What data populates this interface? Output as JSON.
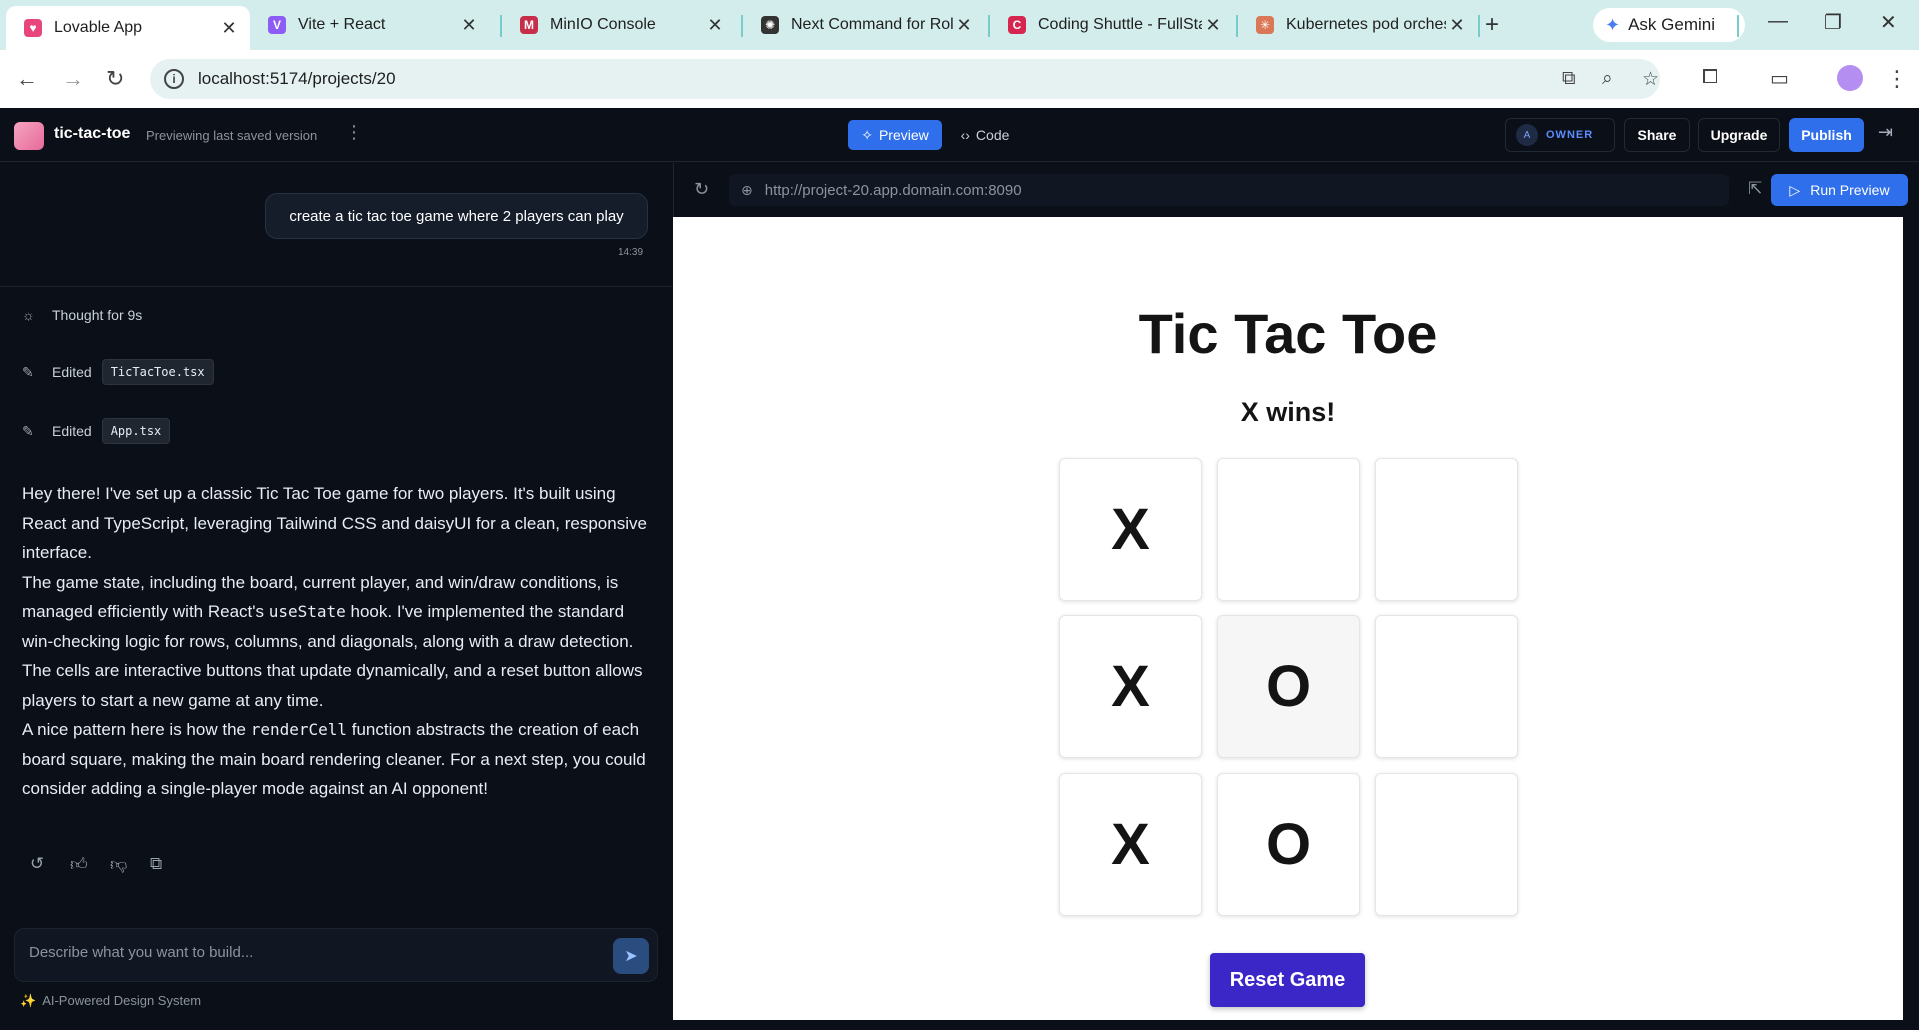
{
  "browser": {
    "tabs": [
      {
        "title": "Lovable App",
        "icon": "lovable-heart-icon",
        "color": "#e8457a",
        "active": true
      },
      {
        "title": "Vite + React",
        "icon": "vite-icon",
        "color": "#8c5cf5",
        "active": false
      },
      {
        "title": "MinIO Console",
        "icon": "minio-icon",
        "color": "#c72e49",
        "active": false
      },
      {
        "title": "Next Command for Rol",
        "icon": "chatgpt-icon",
        "color": "#333333",
        "active": false
      },
      {
        "title": "Coding Shuttle - FullSta",
        "icon": "coding-shuttle-icon",
        "color": "#d6264f",
        "active": false
      },
      {
        "title": "Kubernetes pod orches",
        "icon": "claude-icon",
        "color": "#d97757",
        "active": false
      }
    ],
    "gemini_label": "Ask Gemini",
    "url": "localhost:5174/projects/20"
  },
  "app": {
    "project_name": "tic-tac-toe",
    "status": "Previewing last saved version",
    "preview_label": "Preview",
    "code_label": "Code",
    "avatar_initial": "A",
    "role": "OWNER",
    "share_label": "Share",
    "upgrade_label": "Upgrade",
    "publish_label": "Publish"
  },
  "chat": {
    "user_message": "create a tic tac toe game where 2 players can play",
    "time": "14:39",
    "thought": "Thought for 9s",
    "edits": [
      {
        "label": "Edited",
        "file": "TicTacToe.tsx"
      },
      {
        "label": "Edited",
        "file": "App.tsx"
      }
    ],
    "reply": {
      "p1": "Hey there! I've set up a classic Tic Tac Toe game for two players. It's built using React and TypeScript, leveraging Tailwind CSS and daisyUI for a clean, responsive interface.",
      "p2a": "The game state, including the board, current player, and win/draw conditions, is managed efficiently with React's ",
      "p2code": "useState",
      "p2b": " hook. I've implemented the standard win-checking logic for rows, columns, and diagonals, along with a draw detection. The cells are interactive buttons that update dynamically, and a reset button allows players to start a new game at any time.",
      "p3a": "A nice pattern here is how the ",
      "p3code": "renderCell",
      "p3b": " function abstracts the creation of each board square, making the main board rendering cleaner. For a next step, you could consider adding a single-player mode against an AI opponent!"
    },
    "input_placeholder": "Describe what you want to build...",
    "footnote": "AI-Powered Design System"
  },
  "preview": {
    "url": "http://project-20.app.domain.com:8090",
    "run_label": "Run Preview"
  },
  "game": {
    "title": "Tic Tac Toe",
    "status": "X wins!",
    "board": [
      "X",
      "",
      "",
      "X",
      "O",
      "",
      "X",
      "O",
      ""
    ],
    "reset_label": "Reset Game"
  }
}
